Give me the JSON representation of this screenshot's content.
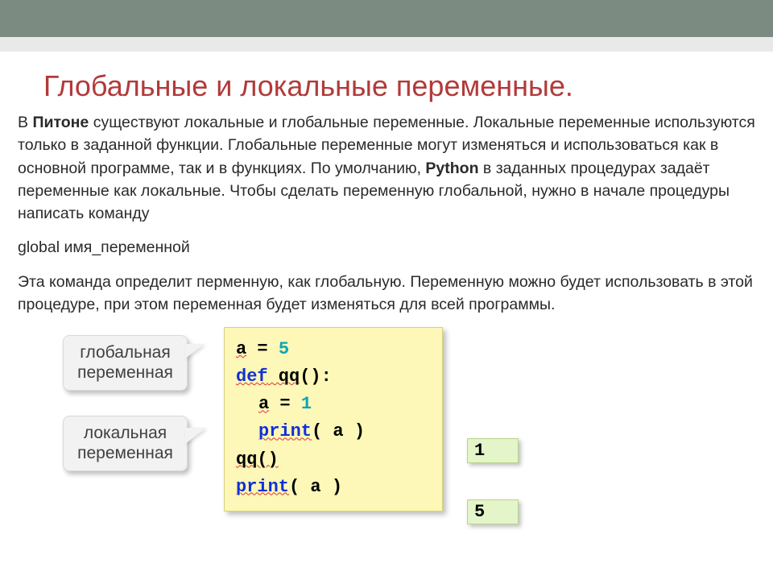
{
  "title": "Глобальные и локальные переменные.",
  "paragraph": {
    "p1a": "В ",
    "p1b": "Питоне",
    "p1c": " существуют локальные и глобальные переменные. Локальные переменные используются только в заданной функции. Глобальные переменные могут изменяться и использоваться как в основной программе, так и в функциях. По умолчанию, ",
    "p1d": "Python",
    "p1e": " в заданных процедурах задаёт переменные как локальные. Чтобы сделать переменную глобальной, нужно в начале процедуры написать команду",
    "p2": "global имя_переменной",
    "p3": "Эта команда определит перменную, как глобальную. Переменную можно будет использовать в этой процедуре, при этом переменная будет изменяться для всей программы."
  },
  "labels": {
    "global_l1": "глобальная",
    "global_l2": "переменная",
    "local_l1": "локальная",
    "local_l2": "переменная"
  },
  "code": {
    "l1_a": "a",
    "l1_eq": " = ",
    "l1_v": "5",
    "l2_kw": "def",
    "l2_fn": " qq",
    "l2_rest": "():",
    "l3_a": "a",
    "l3_eq": " = ",
    "l3_v": "1",
    "l4_fn": "print",
    "l4_rest": "( a )",
    "l5_call": "qq()",
    "l6_fn": "print",
    "l6_rest": "( a )"
  },
  "output": {
    "o1": "1",
    "o2": "5"
  }
}
